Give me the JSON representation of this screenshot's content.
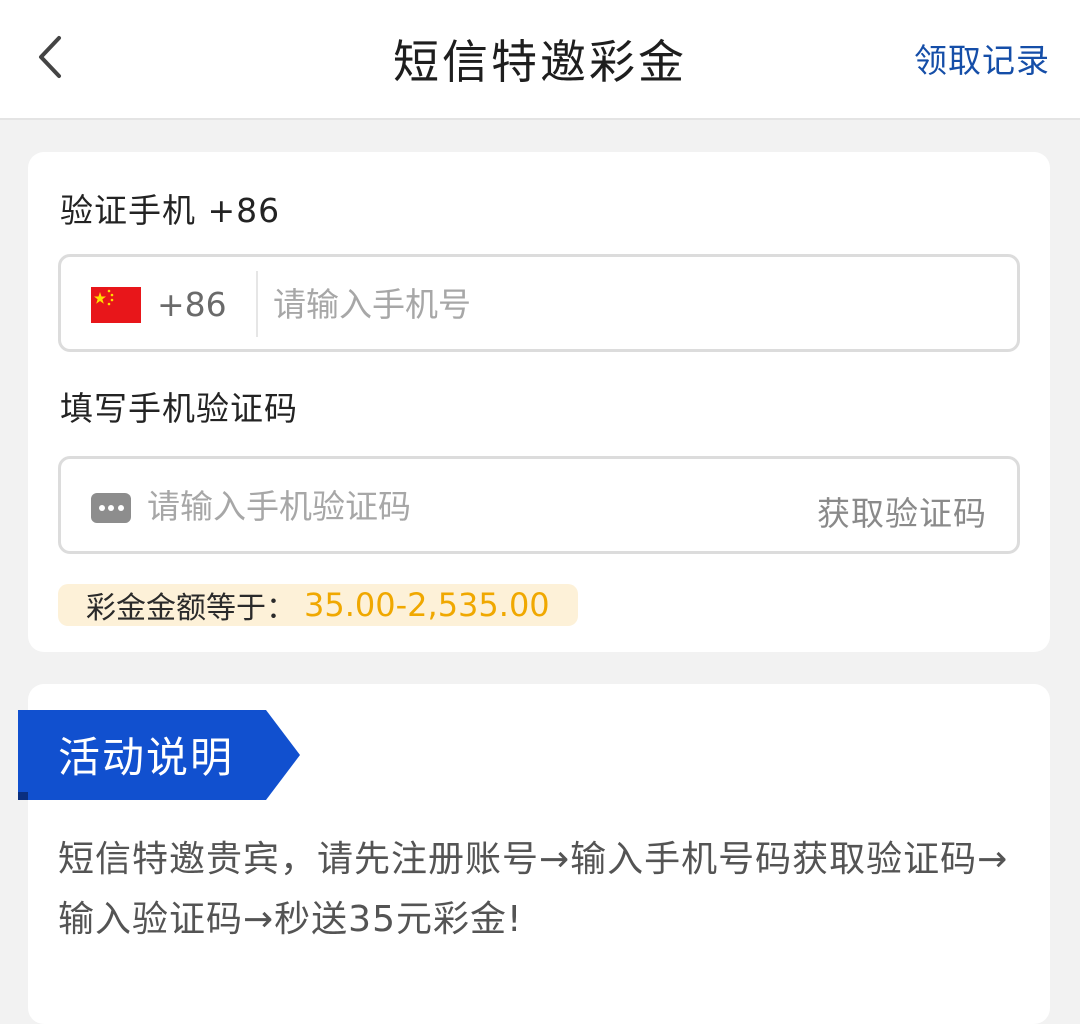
{
  "header": {
    "title": "短信特邀彩金",
    "record_link": "领取记录"
  },
  "form": {
    "phone_label": "验证手机 +86",
    "country_code": "+86",
    "phone_placeholder": "请输入手机号",
    "code_label": "填写手机验证码",
    "code_placeholder": "请输入手机验证码",
    "get_code_button": "获取验证码",
    "amount_label": "彩金金额等于：",
    "amount_value": "35.00-2,535.00"
  },
  "activity": {
    "badge_title": "活动说明",
    "description": "短信特邀贵宾，请先注册账号→输入手机号码获取验证码→输入验证码→秒送35元彩金!"
  },
  "colors": {
    "accent_blue": "#1150cf",
    "link_blue": "#154ea8",
    "amount_gold": "#f0a800"
  },
  "icons": [
    "back-arrow-icon",
    "china-flag-icon",
    "sms-icon"
  ]
}
